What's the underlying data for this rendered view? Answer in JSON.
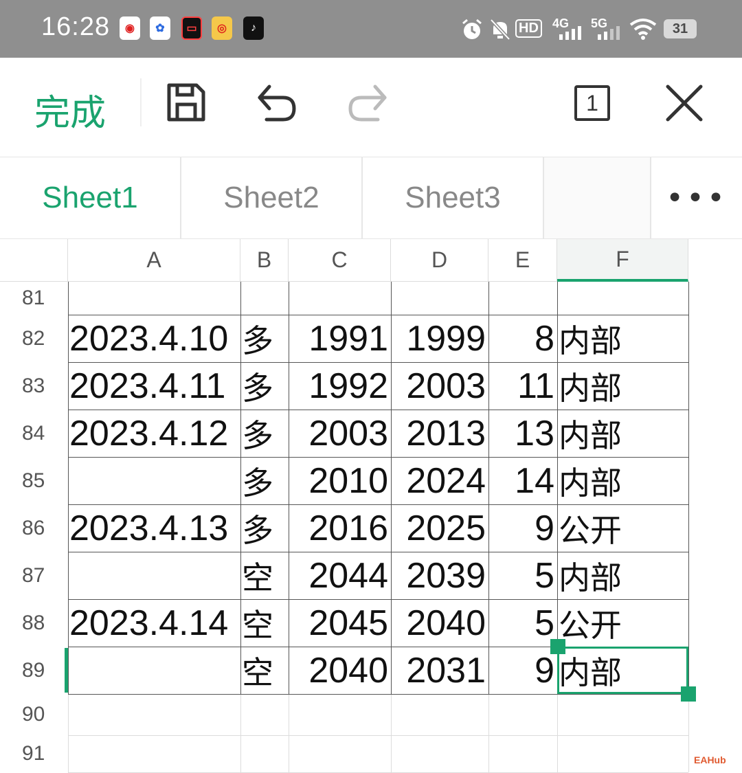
{
  "status_bar": {
    "time": "16:28",
    "network_labels": [
      "HD",
      "4G",
      "5G"
    ],
    "battery": "31"
  },
  "toolbar": {
    "done_label": "完成",
    "window_count": "1"
  },
  "sheets": {
    "tabs": [
      "Sheet1",
      "Sheet2",
      "Sheet3"
    ],
    "active": "Sheet1",
    "more_label": "•••"
  },
  "grid": {
    "columns": [
      "A",
      "B",
      "C",
      "D",
      "E",
      "F"
    ],
    "selected_column": "F",
    "rows": [
      {
        "num": "81",
        "cells": [
          "",
          "",
          "",
          "",
          "",
          ""
        ]
      },
      {
        "num": "82",
        "cells": [
          "2023.4.10",
          "多",
          "1991",
          "1999",
          "8",
          "内部"
        ]
      },
      {
        "num": "83",
        "cells": [
          "2023.4.11",
          "多",
          "1992",
          "2003",
          "11",
          "内部"
        ]
      },
      {
        "num": "84",
        "cells": [
          "2023.4.12",
          "多",
          "2003",
          "2013",
          "13",
          "内部"
        ]
      },
      {
        "num": "85",
        "cells": [
          "",
          "多",
          "2010",
          "2024",
          "14",
          "内部"
        ]
      },
      {
        "num": "86",
        "cells": [
          "2023.4.13",
          "多",
          "2016",
          "2025",
          "9",
          "公开"
        ]
      },
      {
        "num": "87",
        "cells": [
          "",
          "空",
          "2044",
          "2039",
          "5",
          "内部"
        ]
      },
      {
        "num": "88",
        "cells": [
          "2023.4.14",
          "空",
          "2045",
          "2040",
          "5",
          "公开"
        ]
      },
      {
        "num": "89",
        "cells": [
          "",
          "空",
          "2040",
          "2031",
          "9",
          "内部"
        ]
      },
      {
        "num": "90",
        "cells": [
          "",
          "",
          "",
          "",
          "",
          ""
        ]
      },
      {
        "num": "91",
        "cells": [
          "",
          "",
          "",
          "",
          "",
          ""
        ]
      }
    ],
    "selected_cell": "F89"
  },
  "watermark": "EAHub",
  "colors": {
    "accent": "#1aa36e",
    "status_bar": "#8f8f8f"
  }
}
